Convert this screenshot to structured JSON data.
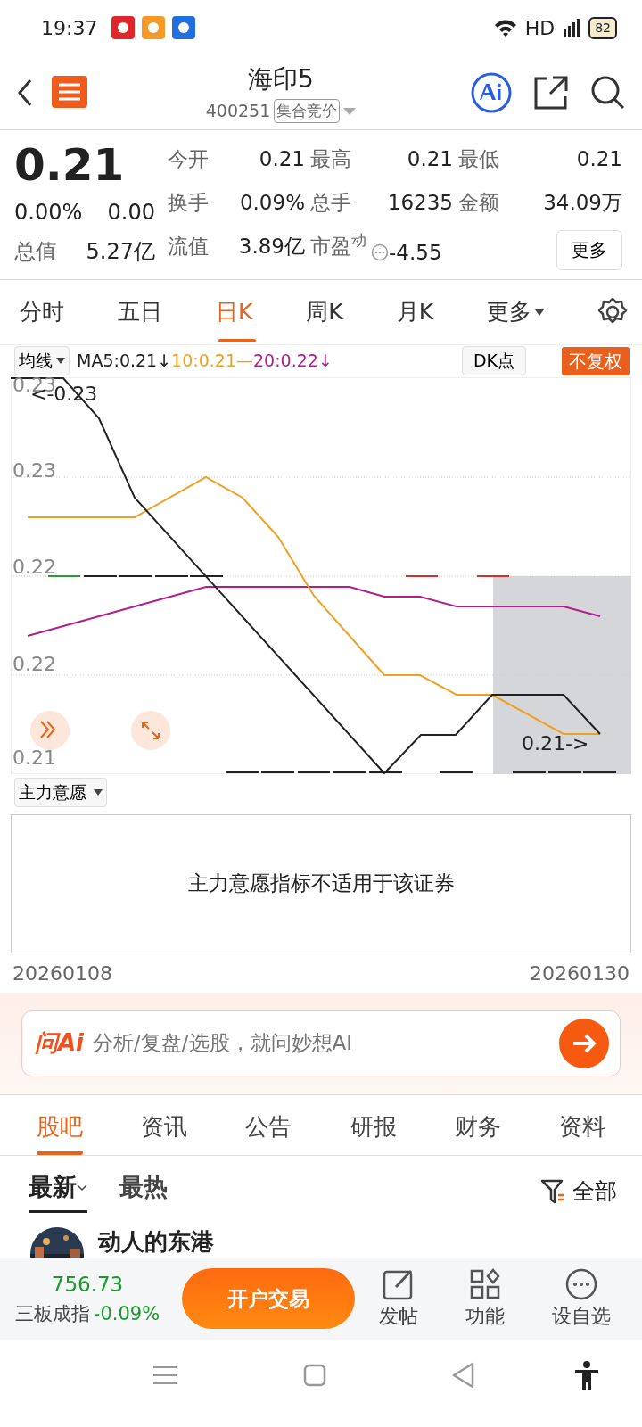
{
  "status_bar": {
    "time": "19:37",
    "network": "HD",
    "battery": "82"
  },
  "header": {
    "title": "海印5",
    "code": "400251",
    "tag": "集合竞价"
  },
  "quote": {
    "price": "0.21",
    "change_pct": "0.00%",
    "change": "0.00",
    "fields": [
      {
        "label": "今开",
        "value": "0.21"
      },
      {
        "label": "最高",
        "value": "0.21"
      },
      {
        "label": "最低",
        "value": "0.21"
      },
      {
        "label": "换手",
        "value": "0.09%"
      },
      {
        "label": "总手",
        "value": "16235"
      },
      {
        "label": "金额",
        "value": "34.09万"
      }
    ],
    "bottom": [
      {
        "label": "总值",
        "value": "5.27亿"
      },
      {
        "label": "流值",
        "value": "3.89亿"
      }
    ],
    "pe": {
      "label": "市盈",
      "sup": "动",
      "value": "-4.55"
    },
    "more": "更多"
  },
  "period_tabs": [
    {
      "label": "分时",
      "selected": false,
      "kind": "tab"
    },
    {
      "label": "五日",
      "selected": false,
      "kind": "tab"
    },
    {
      "label": "日K",
      "selected": true,
      "kind": "tab"
    },
    {
      "label": "周K",
      "selected": false,
      "kind": "tab"
    },
    {
      "label": "月K",
      "selected": false,
      "kind": "tab"
    },
    {
      "label": "更多",
      "selected": false,
      "kind": "dropdown"
    }
  ],
  "chart_toolbar": {
    "indicator": "均线",
    "ma5": "MA5:0.21↓",
    "ma10": "10:0.21",
    "sep": "—",
    "ma20": "20:0.22↓",
    "dk": "DK点",
    "adjust": "不复权"
  },
  "chart": {
    "y_labels": [
      "0.23",
      "0.23",
      "0.22",
      "0.22",
      "0.21"
    ],
    "high_marker": "<-0.23",
    "low_marker": "0.21->"
  },
  "indicator_panel": {
    "selector": "主力意愿",
    "message": "主力意愿指标不适用于该证券"
  },
  "date_range": {
    "start": "20260108",
    "end": "20260130"
  },
  "ai_bar": {
    "logo": "问Ai",
    "placeholder": "分析/复盘/选股，就问妙想AI"
  },
  "content_tabs": [
    {
      "label": "股吧",
      "selected": true
    },
    {
      "label": "资讯",
      "selected": false
    },
    {
      "label": "公告",
      "selected": false
    },
    {
      "label": "研报",
      "selected": false
    },
    {
      "label": "财务",
      "selected": false
    },
    {
      "label": "资料",
      "selected": false
    }
  ],
  "sort": {
    "options": [
      {
        "label": "最新",
        "selected": true
      },
      {
        "label": "最热",
        "selected": false
      }
    ],
    "filter": "全部"
  },
  "post": {
    "author": "动人的东港"
  },
  "bottom_bar": {
    "index_value": "756.73",
    "index_name": "三板成指",
    "index_change": "-0.09%",
    "trade": "开户交易",
    "actions": [
      {
        "label": "发帖",
        "kind": "post"
      },
      {
        "label": "功能",
        "kind": "apps"
      },
      {
        "label": "设自选",
        "kind": "more"
      }
    ]
  }
}
